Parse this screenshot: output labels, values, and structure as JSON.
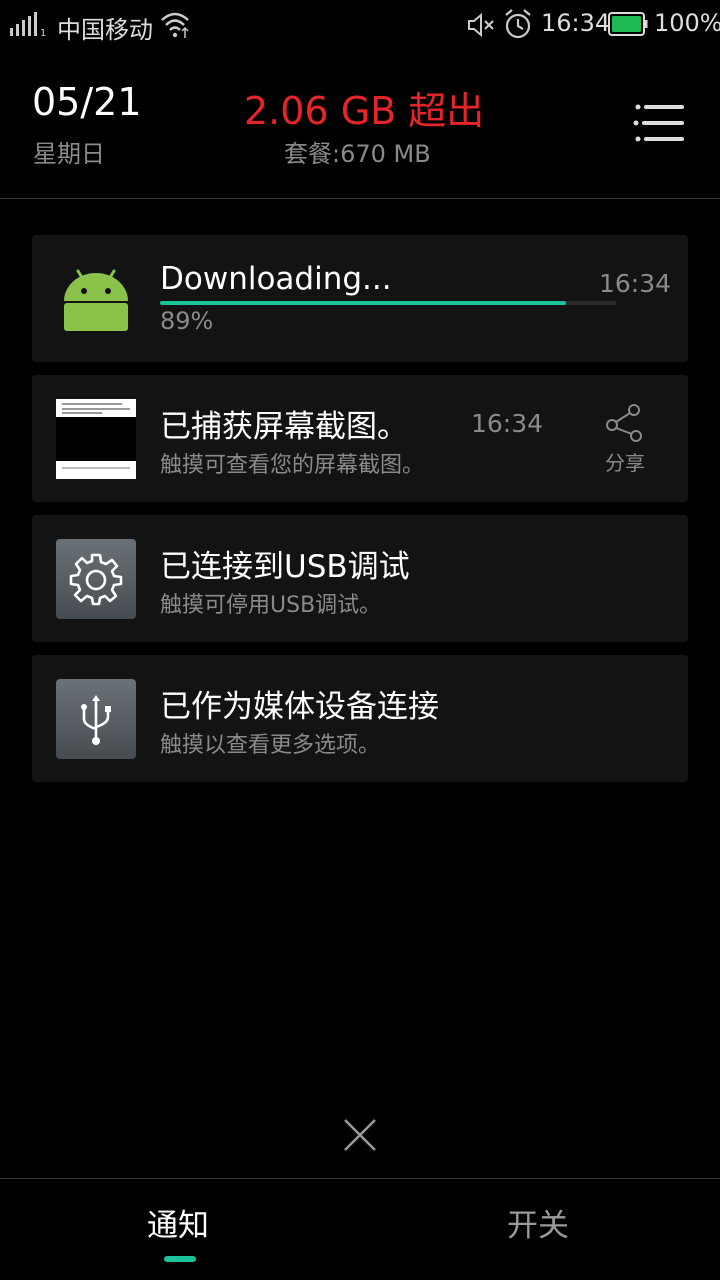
{
  "status_bar": {
    "carrier": "中国移动",
    "time": "16:34",
    "battery_percent": "100%",
    "battery_level": 1.0,
    "icons": [
      "signal-icon",
      "wifi-icon",
      "mute-icon",
      "alarm-icon",
      "battery-icon"
    ]
  },
  "header": {
    "date": "05/21",
    "weekday": "星期日",
    "data_usage": "2.06 GB 超出",
    "plan": "套餐:670 MB",
    "usage_color": "#e5252a"
  },
  "notifications": [
    {
      "title": "Downloading...",
      "time": "16:34",
      "progress_text": "89%",
      "progress": 0.89,
      "icon": "android-icon",
      "accent": "#1bc39a"
    },
    {
      "title": "已捕获屏幕截图。",
      "subtitle": "触摸可查看您的屏幕截图。",
      "time": "16:34",
      "action_label": "分享",
      "icon": "screenshot-thumbnail"
    },
    {
      "title": "已连接到USB调试",
      "subtitle": "触摸可停用USB调试。",
      "icon": "settings-gear-icon"
    },
    {
      "title": "已作为媒体设备连接",
      "subtitle": "触摸以查看更多选项。",
      "icon": "usb-icon"
    }
  ],
  "tabs": [
    {
      "label": "通知",
      "active": true
    },
    {
      "label": "开关",
      "active": false
    }
  ]
}
